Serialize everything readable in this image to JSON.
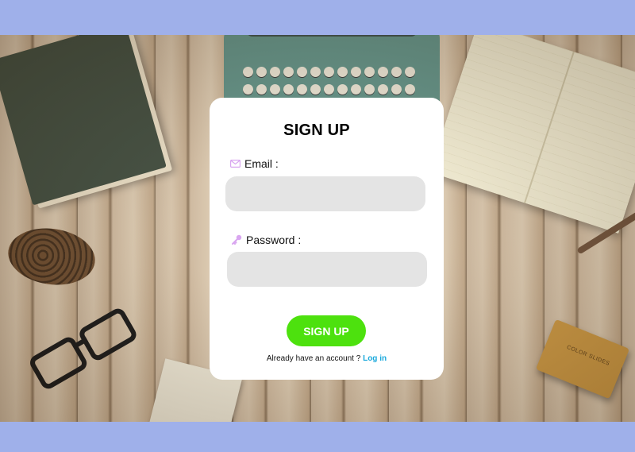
{
  "form": {
    "title": "SIGN UP",
    "email_label": "Email :",
    "password_label": "Password :",
    "email_value": "",
    "password_value": "",
    "submit_label": "SIGN UP",
    "footer_text": "Already have an account ?",
    "login_link": "Log in"
  },
  "background_items": {
    "slides_box_text": "COLOR SLIDES"
  },
  "icons": {
    "email": "envelope-icon",
    "password": "key-icon"
  },
  "colors": {
    "page_band": "#9fb0ea",
    "card": "#ffffff",
    "input_fill": "#e4e4e4",
    "submit_button": "#4de10e",
    "link": "#1aa9dc",
    "icon_tint": "#d9a6f0"
  }
}
